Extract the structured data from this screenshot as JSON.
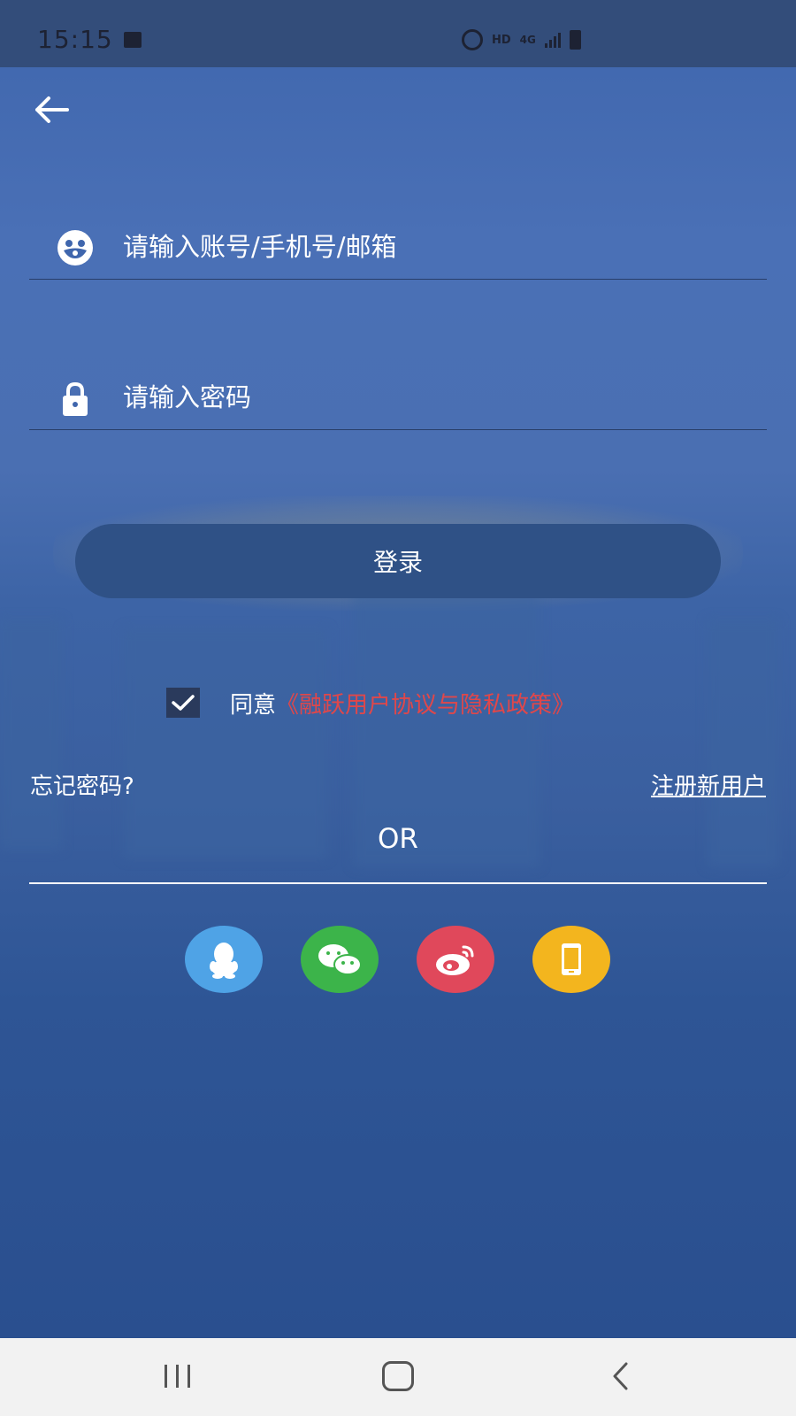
{
  "status_bar": {
    "time": "15:15",
    "hd": "HD",
    "network": "4G",
    "icons": [
      "mail-icon",
      "alarm-icon",
      "signal-icon",
      "battery-icon"
    ]
  },
  "header": {
    "back_icon": "arrow-left-icon"
  },
  "form": {
    "account": {
      "icon": "user-face-icon",
      "placeholder": "请输入账号/手机号/邮箱",
      "value": ""
    },
    "password": {
      "icon": "lock-icon",
      "placeholder": "请输入密码",
      "value": ""
    },
    "login_label": "登录"
  },
  "agreement": {
    "checked": true,
    "prefix": "同意",
    "link_text": "《融跃用户协议与隐私政策》",
    "link_color": "#e0474a"
  },
  "links": {
    "forgot": "忘记密码?",
    "register": "注册新用户"
  },
  "divider": {
    "label": "OR"
  },
  "social": [
    {
      "name": "qq",
      "icon": "qq-icon",
      "color": "#4fa3e6"
    },
    {
      "name": "wechat",
      "icon": "wechat-icon",
      "color": "#3cb44a"
    },
    {
      "name": "weibo",
      "icon": "weibo-icon",
      "color": "#e0485b"
    },
    {
      "name": "phone",
      "icon": "phone-icon",
      "color": "#f3b51e"
    }
  ],
  "nav": {
    "icons": [
      "recents-icon",
      "home-icon",
      "back-icon"
    ]
  },
  "theme": {
    "primary": "#2f5186",
    "background": "#3f66ad"
  }
}
